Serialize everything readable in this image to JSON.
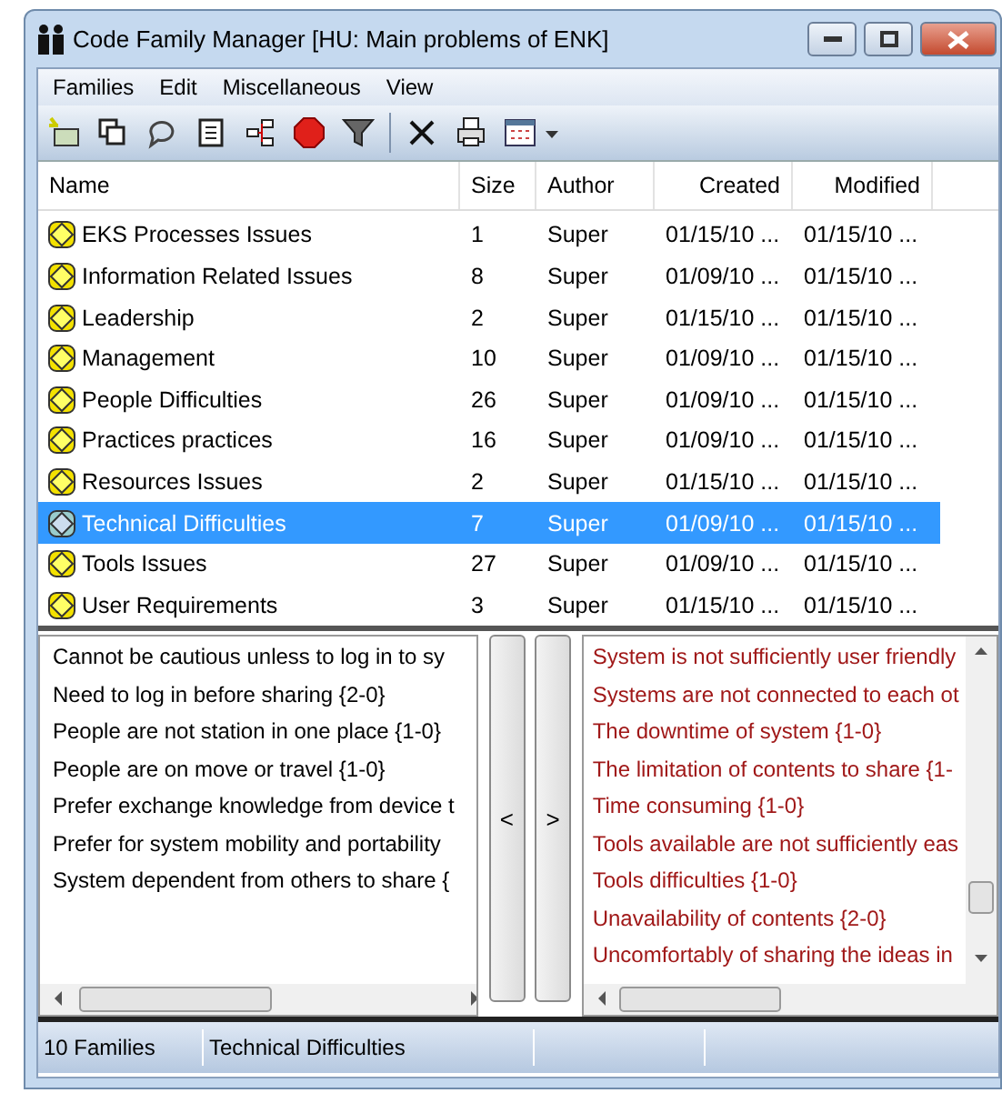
{
  "window": {
    "title": "Code Family Manager [HU: Main problems of ENK]"
  },
  "menu": [
    "Families",
    "Edit",
    "Miscellaneous",
    "View"
  ],
  "table": {
    "columns": [
      "Name",
      "Size",
      "Author",
      "Created",
      "Modified"
    ],
    "rows": [
      {
        "name": "EKS Processes Issues",
        "size": "1",
        "author": "Super",
        "created": "01/15/10 ...",
        "modified": "01/15/10 ...",
        "selected": false
      },
      {
        "name": "Information Related Issues",
        "size": "8",
        "author": "Super",
        "created": "01/09/10 ...",
        "modified": "01/15/10 ...",
        "selected": false
      },
      {
        "name": "Leadership",
        "size": "2",
        "author": "Super",
        "created": "01/15/10 ...",
        "modified": "01/15/10 ...",
        "selected": false
      },
      {
        "name": "Management",
        "size": "10",
        "author": "Super",
        "created": "01/09/10 ...",
        "modified": "01/15/10 ...",
        "selected": false
      },
      {
        "name": "People Difficulties",
        "size": "26",
        "author": "Super",
        "created": "01/09/10 ...",
        "modified": "01/15/10 ...",
        "selected": false
      },
      {
        "name": "Practices practices",
        "size": "16",
        "author": "Super",
        "created": "01/09/10 ...",
        "modified": "01/15/10 ...",
        "selected": false
      },
      {
        "name": "Resources Issues",
        "size": "2",
        "author": "Super",
        "created": "01/15/10 ...",
        "modified": "01/15/10 ...",
        "selected": false
      },
      {
        "name": "Technical Difficulties",
        "size": "7",
        "author": "Super",
        "created": "01/09/10 ...",
        "modified": "01/15/10 ...",
        "selected": true
      },
      {
        "name": "Tools Issues",
        "size": "27",
        "author": "Super",
        "created": "01/09/10 ...",
        "modified": "01/15/10 ...",
        "selected": false
      },
      {
        "name": "User Requirements",
        "size": "3",
        "author": "Super",
        "created": "01/15/10 ...",
        "modified": "01/15/10 ...",
        "selected": false
      }
    ]
  },
  "members": [
    "Cannot be cautious unless to log in to sy",
    "Need to log in before sharing {2-0}",
    "People are not station in one place {1-0}",
    "People are on move or travel {1-0}",
    "Prefer exchange knowledge from device t",
    "Prefer for system mobility and portability",
    "System dependent from others to share {"
  ],
  "move_buttons": [
    "<",
    ">"
  ],
  "non_members": [
    "System is not sufficiently user friendly",
    "Systems are not connected to each ot",
    "The downtime of system {1-0}",
    "The limitation of contents to share {1-",
    "Time consuming {1-0}",
    "Tools available are not sufficiently eas",
    "Tools difficulties {1-0}",
    "Unavailability of contents {2-0}",
    "Uncomfortably of sharing the ideas in"
  ],
  "status_bar": [
    "10 Families",
    "Technical Difficulties"
  ]
}
